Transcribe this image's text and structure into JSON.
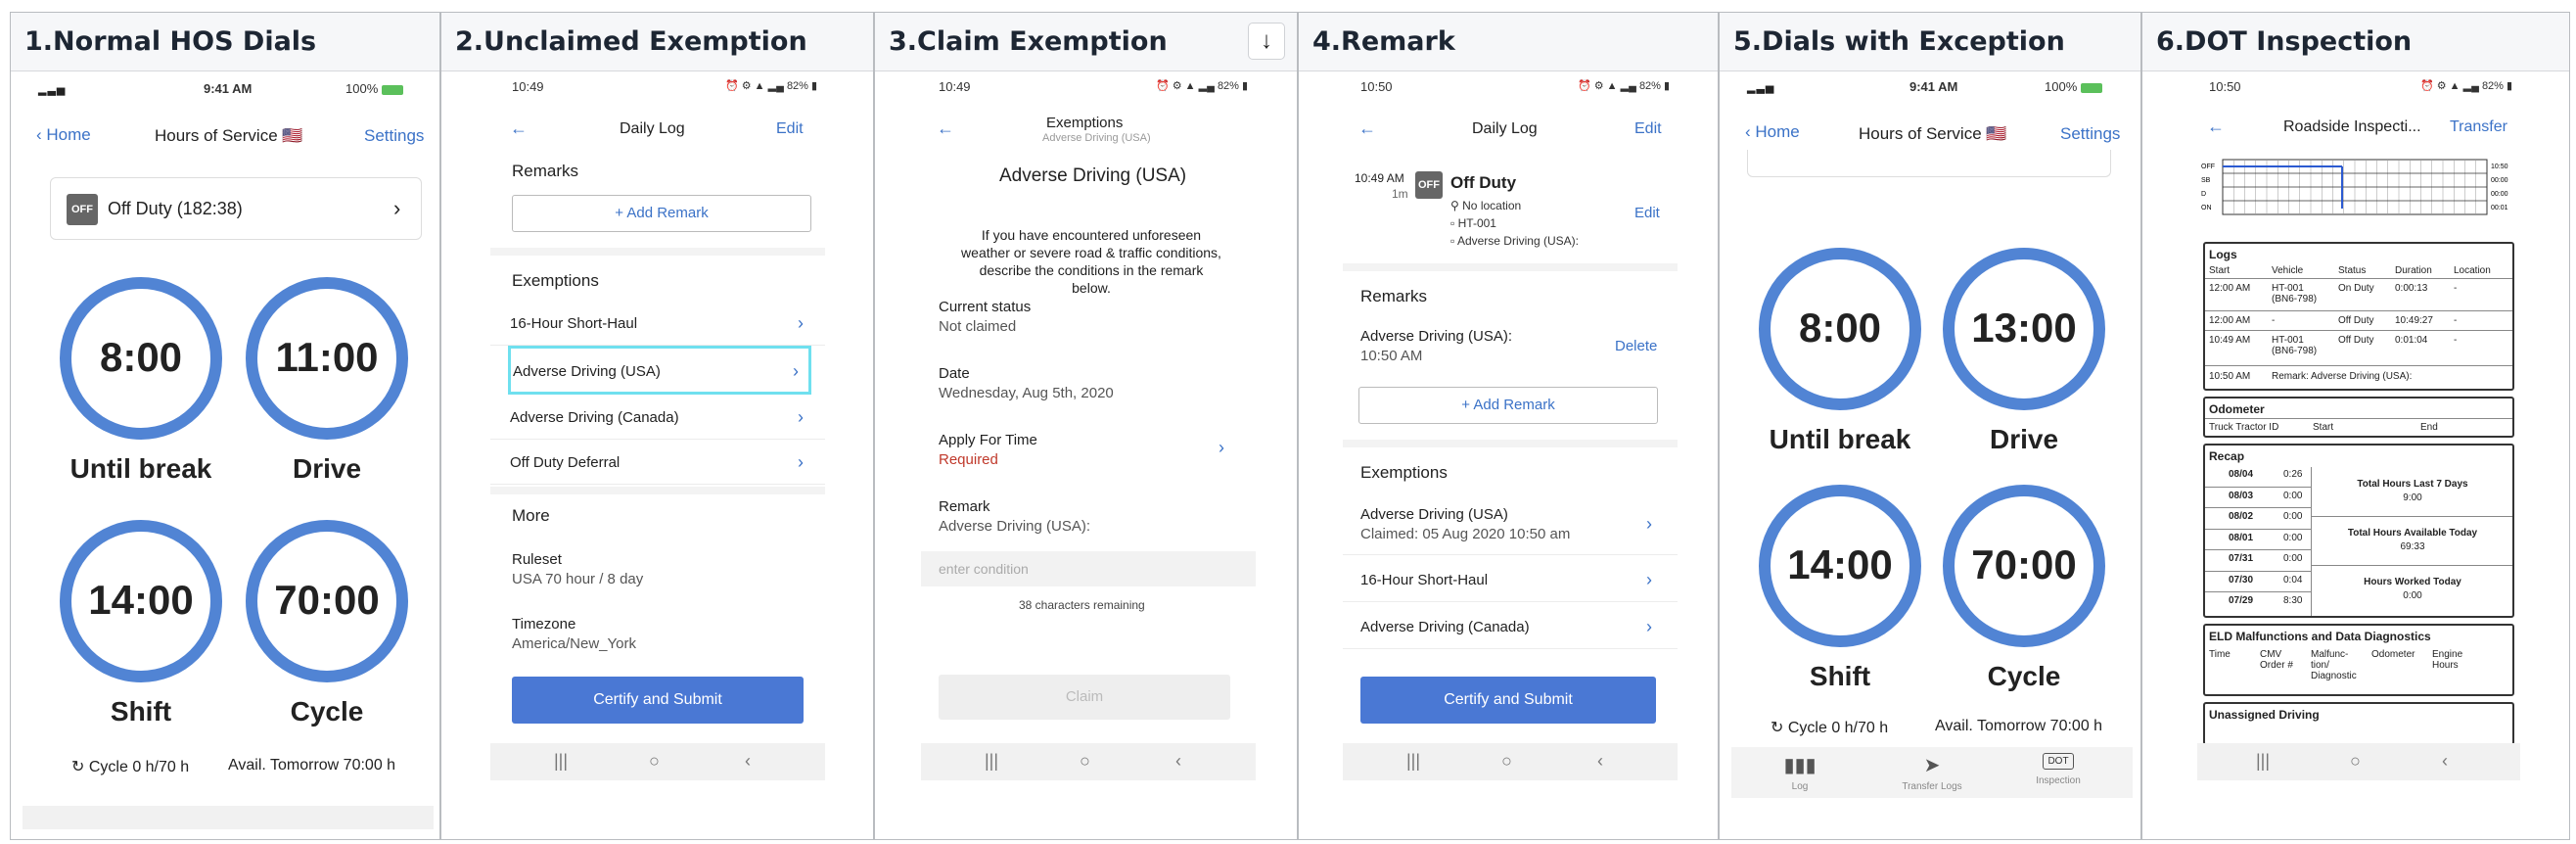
{
  "panels": [
    {
      "title": "1.Normal HOS Dials"
    },
    {
      "title": "2.Unclaimed Exemption"
    },
    {
      "title": "3.Claim Exemption"
    },
    {
      "title": "4.Remark"
    },
    {
      "title": "5.Dials with Exception"
    },
    {
      "title": "6.DOT Inspection"
    }
  ],
  "download_icon": "↓",
  "p1": {
    "time": "9:41 AM",
    "battery": "100%",
    "back": "Home",
    "title": "Hours of Service",
    "flag": "🇺🇸",
    "settings": "Settings",
    "off_badge": "OFF",
    "status": "Off Duty (182:38)",
    "dials": [
      {
        "value": "8:00",
        "label": "Until break"
      },
      {
        "value": "11:00",
        "label": "Drive"
      },
      {
        "value": "14:00",
        "label": "Shift"
      },
      {
        "value": "70:00",
        "label": "Cycle"
      }
    ],
    "cycle": "Cycle 0 h/70 h",
    "avail": "Avail. Tomorrow 70:00 h"
  },
  "p2": {
    "time": "10:49",
    "battery": "82%",
    "title": "Daily Log",
    "edit": "Edit",
    "remarks_header": "Remarks",
    "add_remark": "Add Remark",
    "exemptions_header": "Exemptions",
    "exemptions": [
      "16-Hour Short-Haul",
      "Adverse Driving (USA)",
      "Adverse Driving (Canada)",
      "Off Duty Deferral"
    ],
    "more_header": "More",
    "ruleset_label": "Ruleset",
    "ruleset_value": "USA 70 hour / 8 day",
    "timezone_label": "Timezone",
    "timezone_value": "America/New_York",
    "certify": "Certify and Submit"
  },
  "p3": {
    "time": "10:49",
    "battery": "82%",
    "title": "Exemptions",
    "subtitle": "Adverse Driving (USA)",
    "heading": "Adverse Driving (USA)",
    "desc": "If you have encountered unforeseen weather or severe road & traffic conditions, describe the conditions in the remark below.",
    "status_label": "Current status",
    "status_value": "Not claimed",
    "date_label": "Date",
    "date_value": "Wednesday, Aug 5th, 2020",
    "apply_label": "Apply For Time",
    "apply_value": "Required",
    "remark_label": "Remark",
    "remark_value": "Adverse Driving (USA):",
    "placeholder": "enter condition",
    "chars": "38 characters remaining",
    "claim": "Claim"
  },
  "p4": {
    "time": "10:50",
    "battery": "82%",
    "title": "Daily Log",
    "edit": "Edit",
    "entry_time": "10:49 AM",
    "entry_dur": "1m",
    "off_badge": "OFF",
    "entry_status": "Off Duty",
    "entry_edit": "Edit",
    "entry_lines": [
      "No location",
      "HT-001",
      "Adverse Driving (USA):"
    ],
    "remarks_header": "Remarks",
    "remark_title": "Adverse Driving (USA):",
    "remark_time": "10:50 AM",
    "delete": "Delete",
    "add_remark": "Add Remark",
    "exemptions_header": "Exemptions",
    "ex1": "Adverse Driving (USA)",
    "ex1_sub": "Claimed: 05 Aug 2020 10:50 am",
    "ex2": "16-Hour Short-Haul",
    "ex3": "Adverse Driving (Canada)",
    "certify": "Certify and Submit"
  },
  "p5": {
    "time": "9:41 AM",
    "battery": "100%",
    "back": "Home",
    "title": "Hours of Service",
    "flag": "🇺🇸",
    "settings": "Settings",
    "dials": [
      {
        "value": "8:00",
        "label": "Until break"
      },
      {
        "value": "13:00",
        "label": "Drive"
      },
      {
        "value": "14:00",
        "label": "Shift"
      },
      {
        "value": "70:00",
        "label": "Cycle"
      }
    ],
    "cycle": "Cycle 0 h/70 h",
    "avail": "Avail. Tomorrow 70:00 h",
    "tabs": [
      "Log",
      "Transfer Logs",
      "Inspection"
    ],
    "dot_badge": "DOT"
  },
  "p6": {
    "time": "10:50",
    "battery": "82%",
    "title": "Roadside Inspecti...",
    "transfer": "Transfer",
    "grid_rows": [
      "OFF",
      "SB",
      "D",
      "ON"
    ],
    "grid_totals": [
      "10:50",
      "00:00",
      "00:00",
      "00:01"
    ],
    "logs_header": "Logs",
    "logs_cols": [
      "Start",
      "Vehicle",
      "Status",
      "Duration",
      "Location"
    ],
    "logs_rows": [
      [
        "12:00 AM",
        "HT-001 (BN6-798)",
        "On Duty",
        "0:00:13",
        "-"
      ],
      [
        "12:00 AM",
        "-",
        "Off Duty",
        "10:49:27",
        "-"
      ],
      [
        "10:49 AM",
        "HT-001 (BN6-798)",
        "Off Duty",
        "0:01:04",
        "-"
      ]
    ],
    "logs_remark_time": "10:50 AM",
    "logs_remark": "Remark: Adverse Driving (USA):",
    "odo_header": "Odometer",
    "odo_cols": [
      "Truck Tractor ID",
      "Start",
      "End"
    ],
    "recap_header": "Recap",
    "recap_rows": [
      [
        "08/04",
        "0:26"
      ],
      [
        "08/03",
        "0:00"
      ],
      [
        "08/02",
        "0:00"
      ],
      [
        "08/01",
        "0:00"
      ],
      [
        "07/31",
        "0:00"
      ],
      [
        "07/30",
        "0:04"
      ],
      [
        "07/29",
        "8:30"
      ]
    ],
    "recap_totals": [
      {
        "label": "Total Hours Last 7 Days",
        "value": "9:00"
      },
      {
        "label": "Total Hours Available Today",
        "value": "69:33"
      },
      {
        "label": "Hours Worked Today",
        "value": "0:00"
      }
    ],
    "eld_header": "ELD Malfunctions and Data Diagnostics",
    "eld_cols": [
      "Time",
      "CMV Order #",
      "Malfunc-tion/ Diagnostic",
      "Odometer",
      "Engine Hours"
    ],
    "unassigned_header": "Unassigned Driving"
  }
}
